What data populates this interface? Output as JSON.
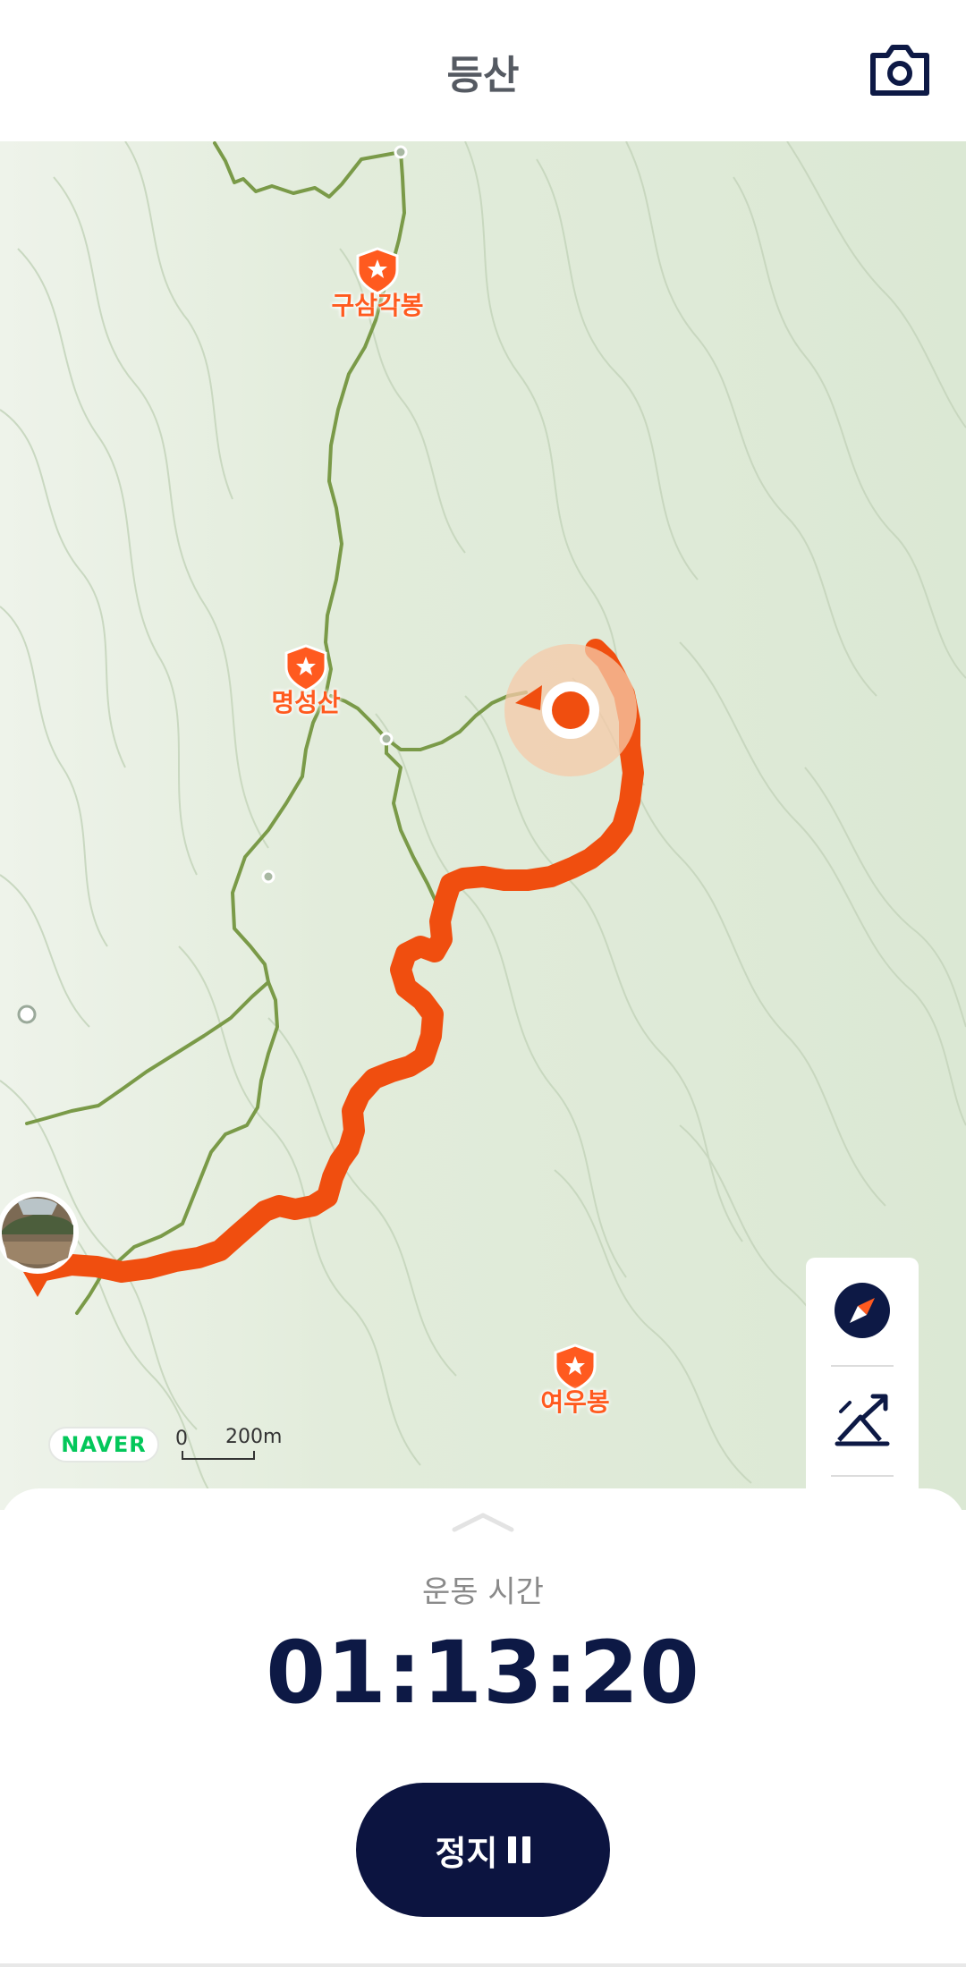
{
  "header": {
    "title": "등산",
    "camera_icon": "camera-icon"
  },
  "map": {
    "pois": [
      {
        "name": "구삼각봉"
      },
      {
        "name": "명성산"
      },
      {
        "name": "여우봉"
      }
    ],
    "logo": "NAVER",
    "scale_zero": "0",
    "scale_distance": "200m",
    "colors": {
      "track": "#f04e0f",
      "trail": "#7a9a48",
      "poi": "#ff5a1f",
      "map_bg": "#dde9d7"
    }
  },
  "controls": {
    "icons": [
      "compass-icon",
      "elevation-icon",
      "locate-icon"
    ]
  },
  "sheet": {
    "time_label": "운동 시간",
    "time_value": "01:13:20",
    "stop_label": "정지",
    "accent": "#0c1440"
  }
}
